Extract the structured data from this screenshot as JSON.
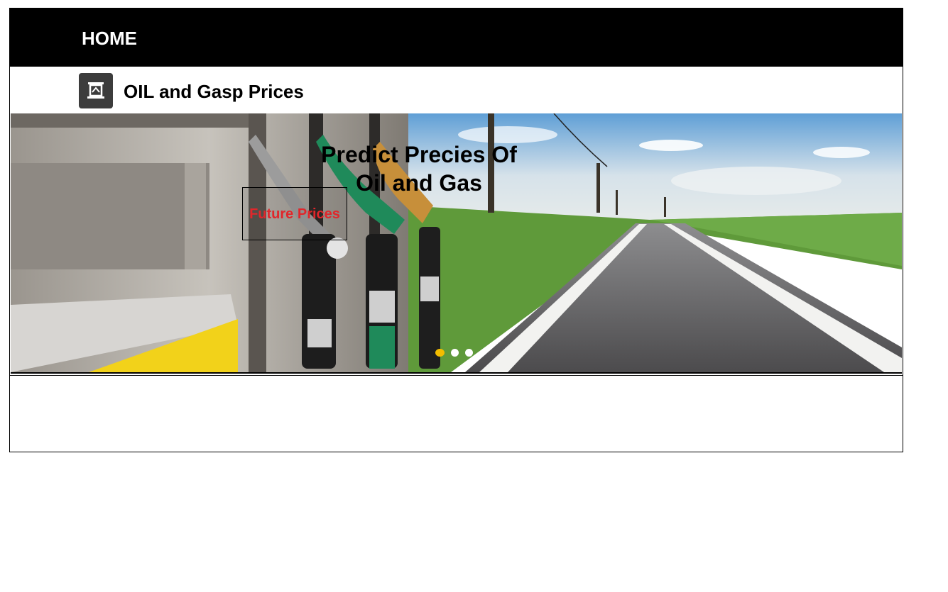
{
  "nav": {
    "home_label": "HOME"
  },
  "brand": {
    "title": "OIL and Gasp Prices",
    "icon": "pump-icon"
  },
  "hero": {
    "heading_line1": "Predict Precies Of",
    "heading_line2": "Oil and Gas",
    "cta_label": "Future Prices",
    "slides_count": 3,
    "active_slide": 1
  },
  "colors": {
    "nav_bg": "#000000",
    "cta_text": "#e1262b",
    "active_dot": "#f3bd00",
    "logo_bg": "#3c3c3c"
  }
}
